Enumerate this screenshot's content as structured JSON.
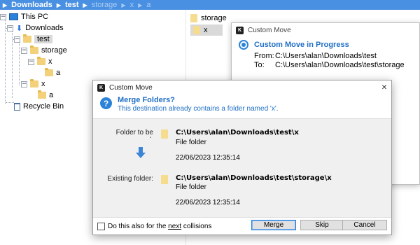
{
  "breadcrumb": {
    "items": [
      "Downloads",
      "test",
      "storage",
      "x",
      "a"
    ]
  },
  "tree": {
    "this_pc": "This PC",
    "downloads": "Downloads",
    "test": "test",
    "storage": "storage",
    "x1": "x",
    "a1": "a",
    "x2": "x",
    "a2": "a",
    "recycle_bin": "Recycle Bin",
    "expanded_glyph": "−"
  },
  "filelist": {
    "items": [
      "storage",
      "x"
    ]
  },
  "progress": {
    "title": "Custom Move",
    "heading": "Custom Move in Progress",
    "from_label": "From:",
    "from_value": "C:\\Users\\alan\\Downloads\\test",
    "to_label": "To:",
    "to_value": "C:\\Users\\alan\\Downloads\\test\\storage"
  },
  "dialog": {
    "title": "Custom Move",
    "close_glyph": "✕",
    "heading": "Merge Folders?",
    "subheading": "This destination already contains a folder named 'x'.",
    "source_label": "Folder to be moved:",
    "source_path": "C:\\Users\\alan\\Downloads\\test\\x",
    "source_type": "File folder",
    "source_date": "22/06/2023 12:35:14",
    "existing_label": "Existing folder:",
    "existing_path": "C:\\Users\\alan\\Downloads\\test\\storage\\x",
    "existing_type": "File folder",
    "existing_date": "22/06/2023 12:35:14",
    "checkbox_pre": "Do this also for the ",
    "checkbox_underlined": "next",
    "checkbox_post": " collisions",
    "merge_label": "Merge",
    "skip_label": "Skip",
    "cancel_label": "Cancel"
  },
  "colors": {
    "accent": "#1f6fc5",
    "breadcrumb_bar": "#4a90e2",
    "folder": "#f3d07a"
  }
}
